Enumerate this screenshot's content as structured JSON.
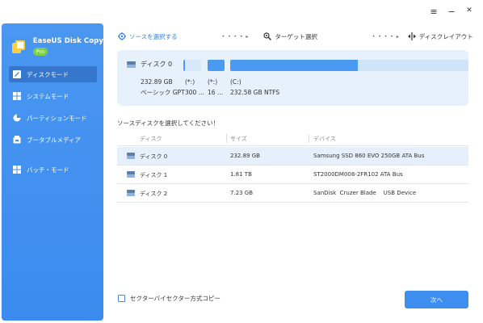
{
  "app": {
    "name": "EaseUS Disk Copy",
    "badge": "Pro"
  },
  "window_controls": {
    "menu": "≡",
    "minimize": "−",
    "close": "✕"
  },
  "sidebar": {
    "items": [
      {
        "label": "ディスクモード",
        "icon": "disk-mode-icon",
        "active": true
      },
      {
        "label": "システムモード",
        "icon": "windows-icon",
        "active": false
      },
      {
        "label": "パーティションモード",
        "icon": "pie-chart-icon",
        "active": false
      },
      {
        "label": "ブータブルメディア",
        "icon": "bootable-media-icon",
        "active": false
      },
      {
        "label": "バッチ・モード",
        "icon": "batch-mode-icon",
        "active": false
      }
    ]
  },
  "steps": [
    {
      "label": "ソースを選択する",
      "icon": "crosshair-icon",
      "active": true
    },
    {
      "label": "ターゲット選択",
      "icon": "target-search-icon",
      "active": false
    },
    {
      "label": "ディスクレイアウト",
      "icon": "layout-icon",
      "active": false
    }
  ],
  "step_separator": "• • • • ▸",
  "disk_panel": {
    "title": "ディスク 0",
    "size": "232.89 GB",
    "type": "ベーシック GPT",
    "partitions": [
      {
        "name": "(*:)",
        "detail": "300 ..."
      },
      {
        "name": "(*:)",
        "detail": "16 ..."
      },
      {
        "name": "(C:)",
        "detail": "232.58 GB NTFS",
        "used_fraction": 0.535
      }
    ]
  },
  "source_prompt": "ソースディスクを選択してください！",
  "table": {
    "headers": [
      "ディスク",
      "サイズ",
      "デバイス"
    ],
    "rows": [
      {
        "disk": "ディスク 0",
        "size": "232.89 GB",
        "device": "Samsung SSD 860 EVO 250GB ATA Bus",
        "selected": true
      },
      {
        "disk": "ディスク 1",
        "size": "1.81 TB",
        "device": "ST2000DM008-2FR102 ATA Bus",
        "selected": false
      },
      {
        "disk": "ディスク 2",
        "size": "7.23 GB",
        "device": "SanDisk  Cruzer Blade    USB Device",
        "selected": false
      }
    ]
  },
  "sector_copy_label": "セクターバイセクター方式コピー",
  "next_button": "次へ",
  "colors": {
    "sidebar": "#3f8ff0",
    "accent": "#2f7de6",
    "panel_bg": "#e7f1fc",
    "partition_fill": "#4a9af2",
    "partition_empty": "#cfe3f9",
    "selected_row": "#e5f0fc",
    "pro_badge": "#7ecf4a"
  }
}
